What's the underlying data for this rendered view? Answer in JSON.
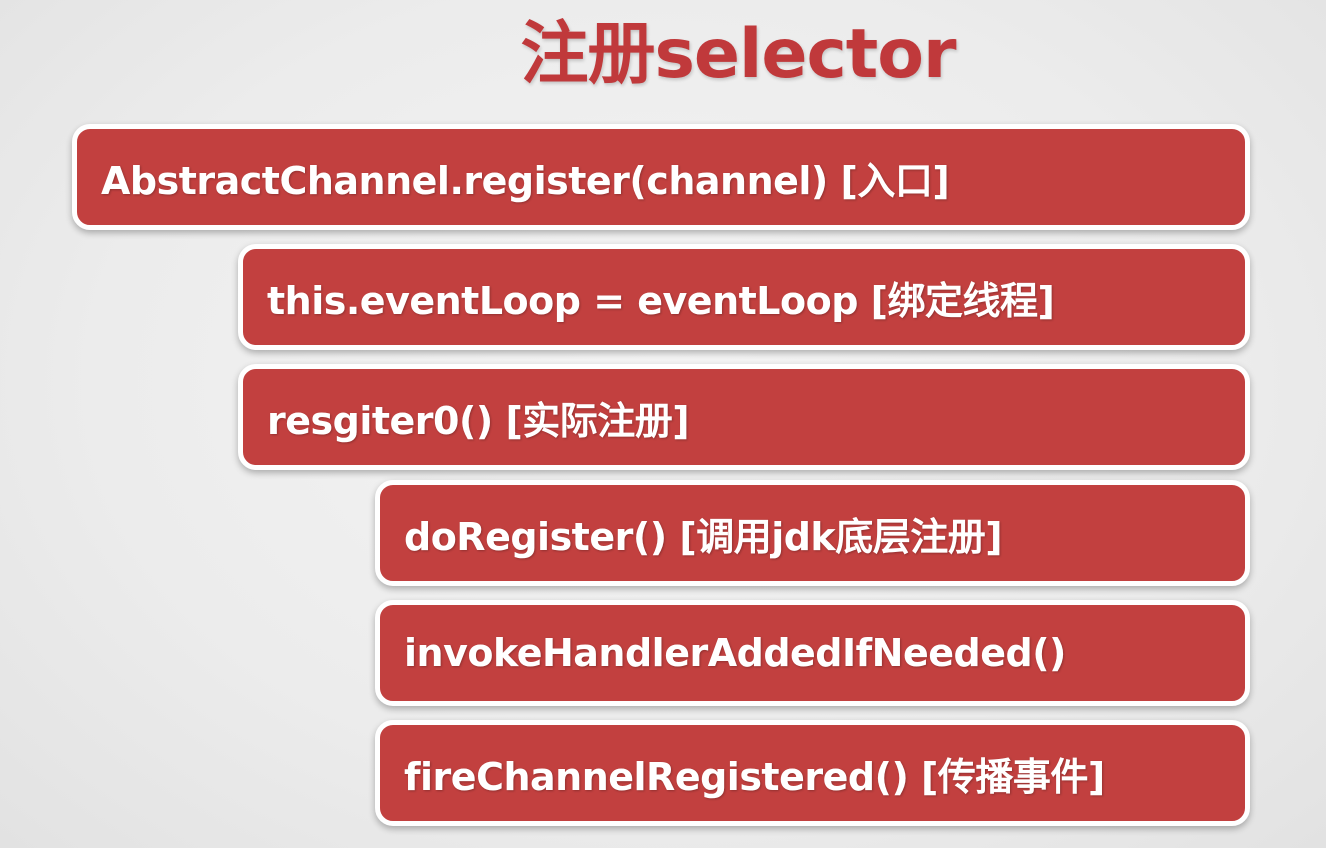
{
  "title": "注册selector",
  "steps": [
    {
      "label": "AbstractChannel.register(channel) [入口]",
      "level": 0
    },
    {
      "label": "this.eventLoop = eventLoop [绑定线程]",
      "level": 1
    },
    {
      "label": "resgiter0() [实际注册]",
      "level": 1
    },
    {
      "label": "doRegister() [调用jdk底层注册]",
      "level": 2
    },
    {
      "label": "invokeHandlerAddedIfNeeded()",
      "level": 2
    },
    {
      "label": "fireChannelRegistered() [传播事件]",
      "level": 2
    }
  ],
  "colors": {
    "title": "#c0393b",
    "box_fill": "#c2403f",
    "box_border": "#ffffff",
    "box_text": "#ffffff",
    "background": "#ececec"
  }
}
